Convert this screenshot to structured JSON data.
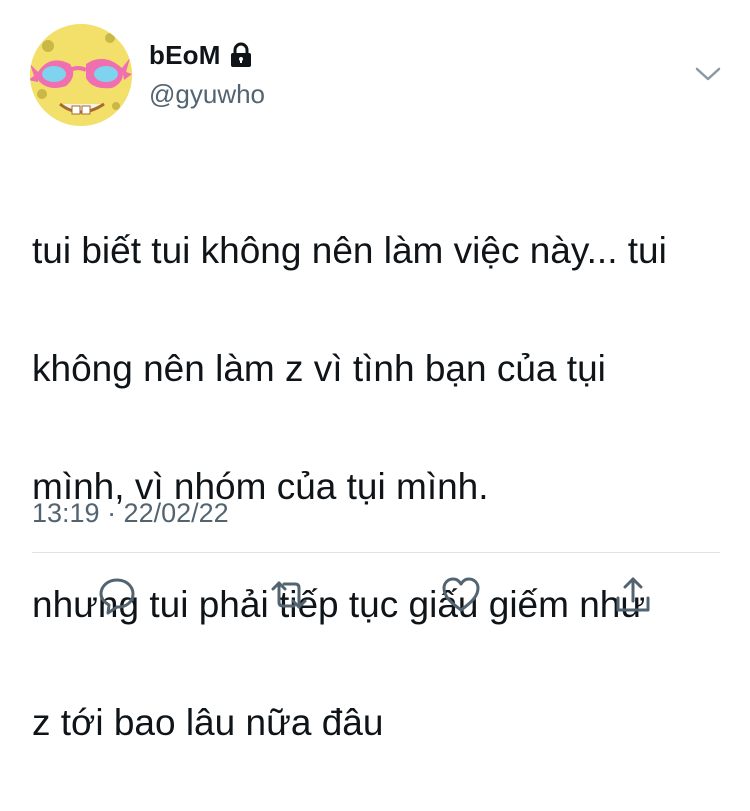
{
  "tweet": {
    "display_name": "bEoM",
    "handle": "@gyuwho",
    "lock_icon": "lock-icon",
    "menu_icon": "chevron-down-icon",
    "text_lines": [
      "tui biết tui không nên làm việc này... tui",
      "không nên làm z vì tình bạn của tụi",
      "mình, vì nhóm của tụi mình.",
      "nhưng tui phải tiếp tục giấu giếm như",
      "z tới bao lâu nữa đâu"
    ],
    "timestamp": "13:19 · 22/02/22"
  },
  "actions": [
    {
      "name": "reply-icon"
    },
    {
      "name": "retweet-icon"
    },
    {
      "name": "like-icon"
    },
    {
      "name": "share-icon"
    }
  ],
  "colors": {
    "secondary_text": "#536471",
    "primary_text": "#0f1419",
    "icon": "#536471",
    "divider": "#dfe3e6"
  }
}
